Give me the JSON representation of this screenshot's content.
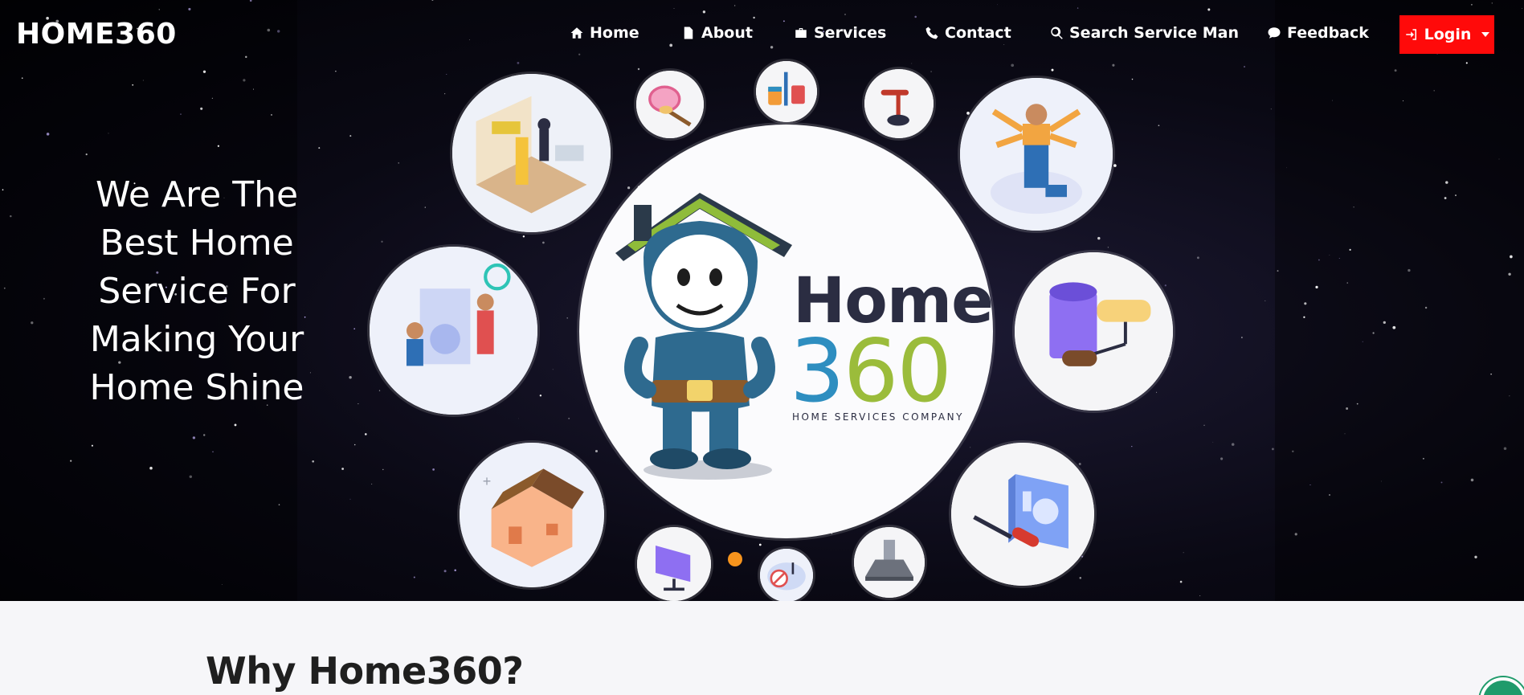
{
  "brand": "HOME360",
  "nav": {
    "home": "Home",
    "about": "About",
    "services": "Services",
    "contact": "Contact",
    "search": "Search Service Man",
    "feedback": "Feedback",
    "login": "Login"
  },
  "hero": {
    "tagline_lines": [
      "We Are The",
      "Best Home",
      "Service For",
      "Making Your",
      "Home Shine"
    ],
    "logo": {
      "word1": "Home",
      "word2_a": "3",
      "word2_b": "60",
      "subtitle": "HOME SERVICES COMPANY"
    },
    "carousel": {
      "active_slide": 1
    }
  },
  "section": {
    "title": "Why Home360?"
  },
  "colors": {
    "login_button": "#ff0a0a",
    "carousel_indicator": "#f7941d",
    "logo_navy": "#2b2d42",
    "logo_blue": "#2e8ec0",
    "logo_green": "#9bbc3b"
  },
  "icons": [
    "home-icon",
    "file-icon",
    "briefcase-icon",
    "phone-icon",
    "search-icon",
    "comment-icon",
    "sign-in-icon"
  ]
}
